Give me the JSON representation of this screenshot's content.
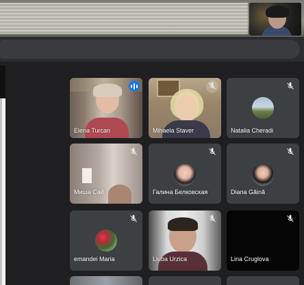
{
  "participants": [
    {
      "name": "Elena Turcan",
      "muted": false,
      "speaking": true,
      "video": true
    },
    {
      "name": "Mihaela Staver",
      "muted": true,
      "speaking": false,
      "video": true
    },
    {
      "name": "Natalia Cheradi",
      "muted": true,
      "speaking": false,
      "video": false,
      "avatar": "landscape-photo"
    },
    {
      "name": "Миша Сай",
      "muted": true,
      "speaking": false,
      "video": true
    },
    {
      "name": "Галина Белковская",
      "muted": true,
      "speaking": false,
      "video": false,
      "avatar": "portrait-photo"
    },
    {
      "name": "Diana Găină",
      "muted": true,
      "speaking": false,
      "video": false,
      "avatar": "portrait-photo"
    },
    {
      "name": "emandei Maria",
      "muted": true,
      "speaking": false,
      "video": false,
      "avatar": "berries-photo"
    },
    {
      "name": "Liuba Urzica",
      "muted": true,
      "speaking": false,
      "video": true
    },
    {
      "name": "Lina Cruglova",
      "muted": true,
      "speaking": false,
      "video": true
    }
  ],
  "colors": {
    "tile_background": "#3c4043",
    "page_background": "#1f1f22",
    "speaking_outline": "#8ab4f8",
    "active_mic": "#1a73e8"
  }
}
